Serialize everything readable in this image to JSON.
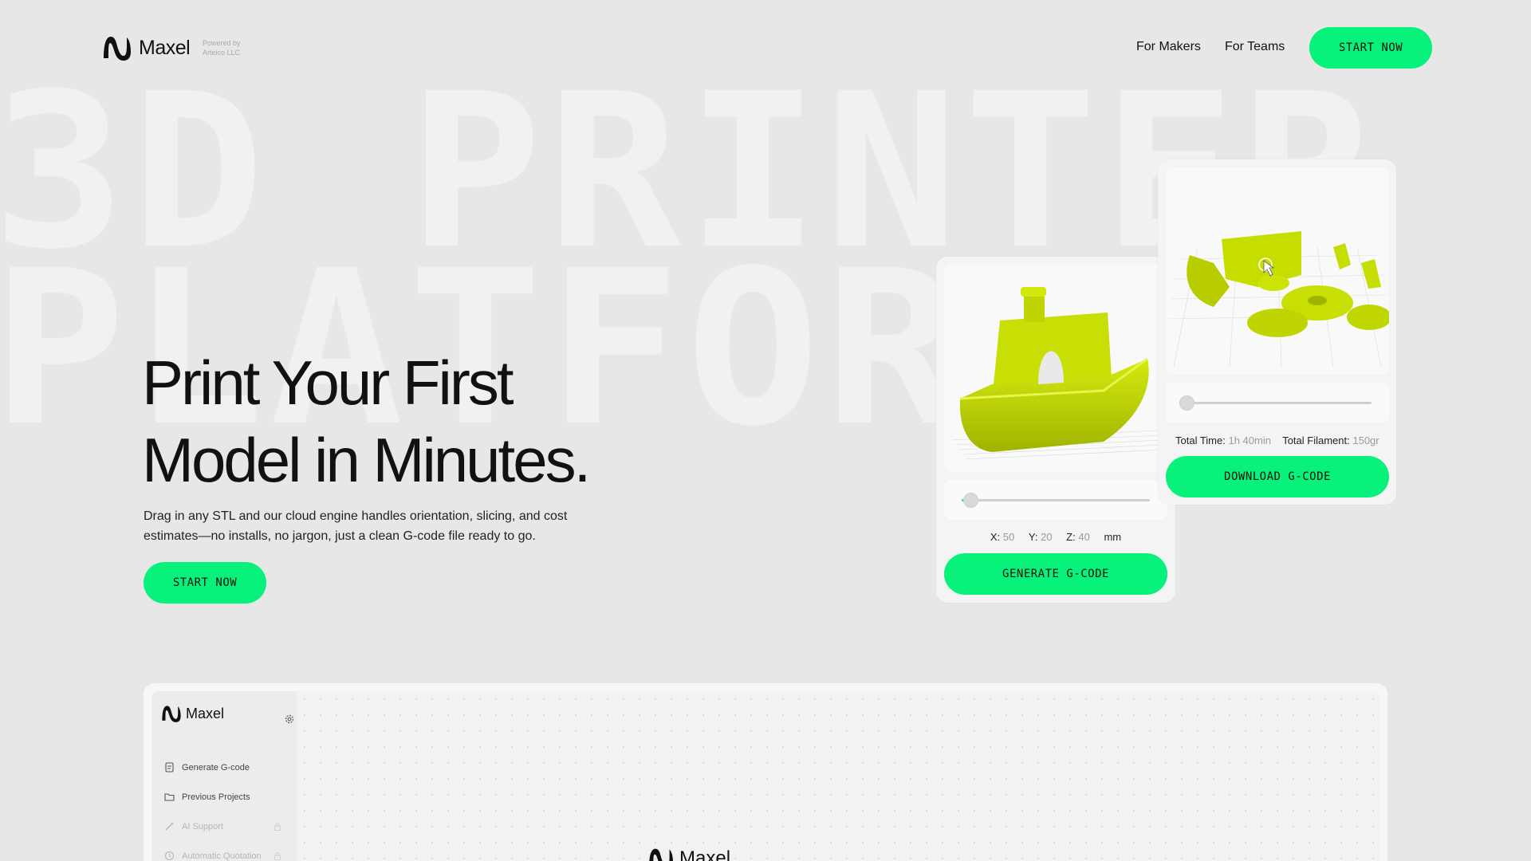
{
  "background_text": {
    "line1": "3D PRINTER",
    "line2": "PLATFORM"
  },
  "nav": {
    "brand": "Maxel",
    "powered_by": "Powered by",
    "company": "Arteico LLC",
    "links": [
      "For Makers",
      "For Teams"
    ],
    "cta": "START NOW"
  },
  "hero": {
    "title_line1": "Print Your First",
    "title_line2": "Model in Minutes.",
    "subtitle": "Drag in any STL and our cloud engine handles orientation, slicing, and cost estimates—no installs, no jargon, just a clean G-code file ready to go.",
    "cta": "START NOW"
  },
  "card_generate": {
    "model_icon": "boat-model-icon",
    "slider_fraction": 0.05,
    "x_label": "X:",
    "x_value": "50",
    "y_label": "Y:",
    "y_value": "20",
    "z_label": "Z:",
    "z_value": "40",
    "unit": "mm",
    "button": "GENERATE G-CODE"
  },
  "card_download": {
    "model_icon": "gear-parts-model-icon",
    "slider_fraction": 0.02,
    "time_label": "Total Time:",
    "time_value": "1h 40min",
    "filament_label": "Total Filament:",
    "filament_value": "150gr",
    "button": "DOWNLOAD G-CODE"
  },
  "app_preview": {
    "brand": "Maxel",
    "menu": [
      {
        "label": "Generate G-code",
        "icon": "document-icon",
        "enabled": true
      },
      {
        "label": "Previous Projects",
        "icon": "folder-icon",
        "enabled": true
      },
      {
        "label": "AI Support",
        "icon": "wand-icon",
        "enabled": false
      },
      {
        "label": "Automatic Quotation",
        "icon": "quote-icon",
        "enabled": false
      }
    ],
    "canvas_brand": "Maxel"
  },
  "colors": {
    "accent": "#08f27b",
    "model": "#c5dd00",
    "background": "#e7e7e7"
  }
}
